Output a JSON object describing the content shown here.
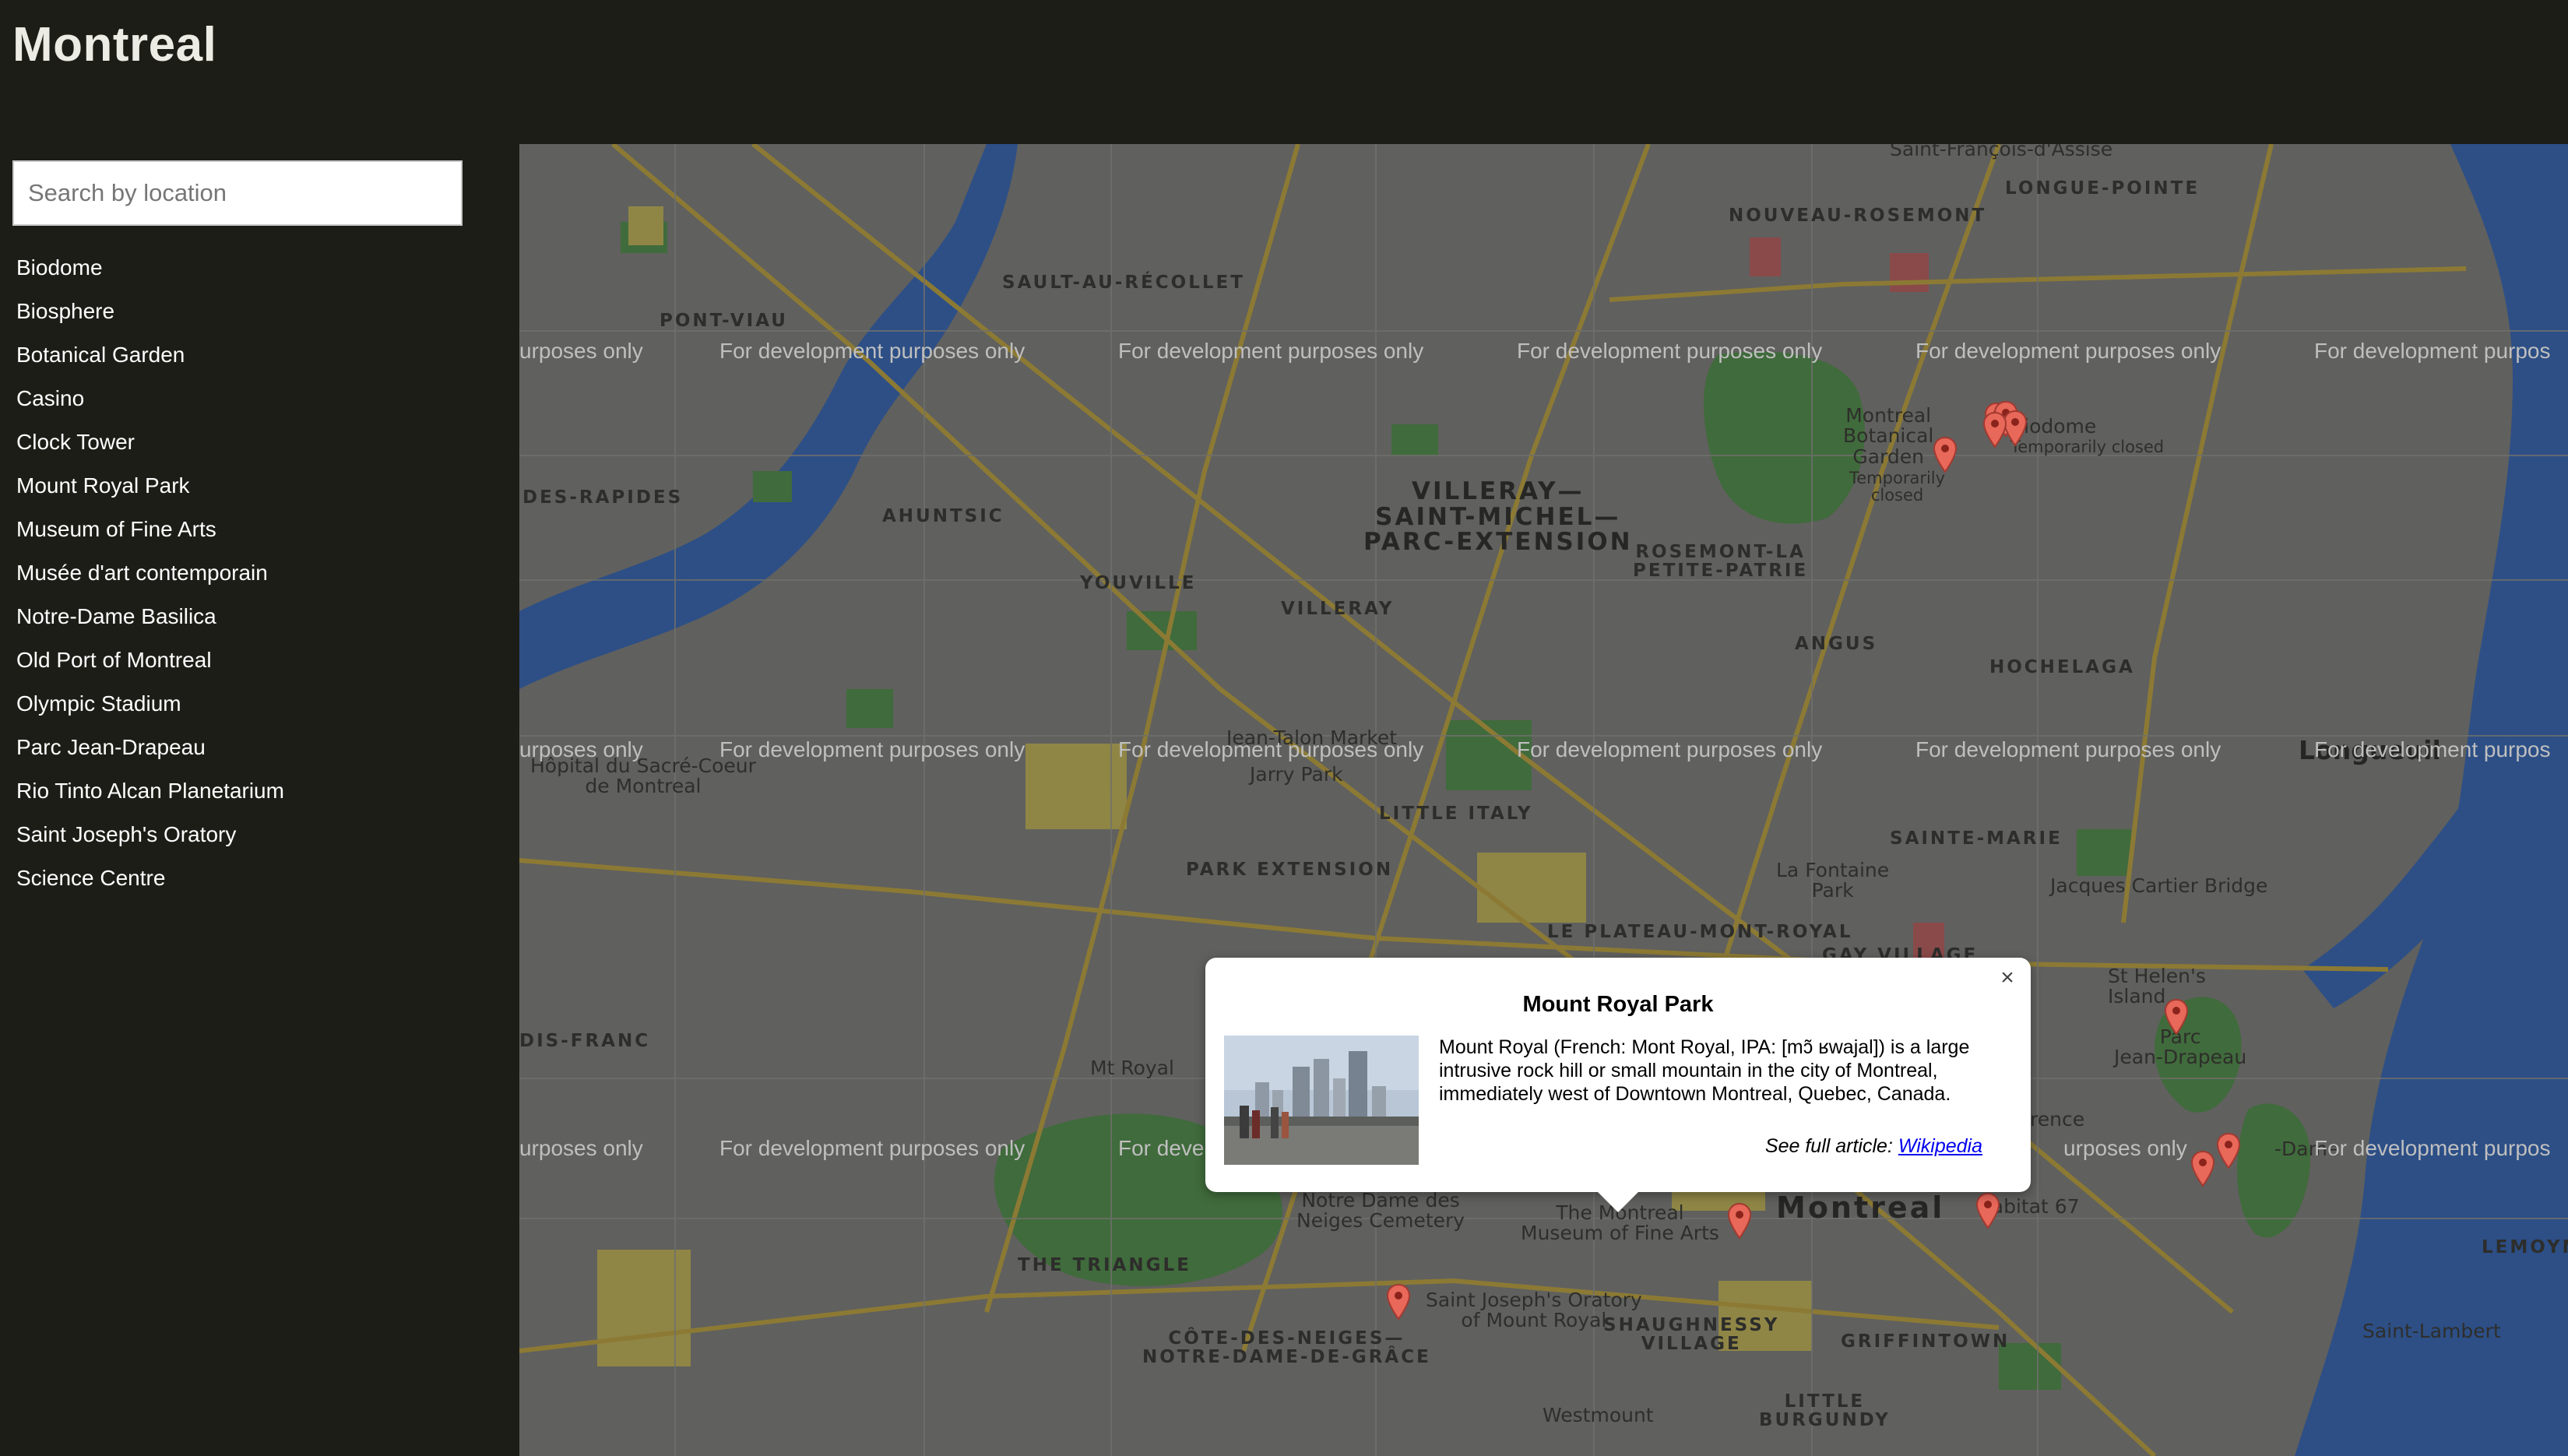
{
  "app": {
    "title": "Montreal"
  },
  "search": {
    "placeholder": "Search by location"
  },
  "locations": [
    "Biodome",
    "Biosphere",
    "Botanical Garden",
    "Casino",
    "Clock Tower",
    "Mount Royal Park",
    "Museum of Fine Arts",
    "Musée d'art contemporain",
    "Notre-Dame Basilica",
    "Old Port of Montreal",
    "Olympic Stadium",
    "Parc Jean-Drapeau",
    "Rio Tinto Alcan Planetarium",
    "Saint Joseph's Oratory",
    "Science Centre"
  ],
  "map": {
    "watermark": "For development purposes only",
    "watermark_partial_left": "urposes only",
    "watermark_partial_right": "For development purpos",
    "watermark_cut_mid": "For deve",
    "labels": {
      "nouveau_rosemont": "NOUVEAU-ROSEMONT",
      "longue_pointe": "LONGUE-POINTE",
      "sault": "SAULT-AU-RÉCOLLET",
      "pont_viau": "PONT-VIAU",
      "des_rapides": "DES-RAPIDES",
      "ahuntsic": "AHUNTSIC",
      "youville": "YOUVILLE",
      "villeray": "VILLERAY",
      "villeray_big": "VILLERAY—\nSAINT-MICHEL—\nPARC-EXTENSION",
      "rosemont": "ROSEMONT-LA\nPETITE-PATRIE",
      "angus": "ANGUS",
      "hochelaga": "HOCHELAGA",
      "little_italy": "LITTLE ITALY",
      "park_extension": "PARK EXTENSION",
      "sainte_marie": "SAINTE-MARIE",
      "plateau": "LE PLATEAU-MONT-ROYAL",
      "gay_village": "GAY VILLAGE",
      "the_triangle": "THE TRIANGLE",
      "cote_des_neiges": "CÔTE-DES-NEIGES—\nNOTRE-DAME-DE-GRÂCE",
      "shaughnessy": "SHAUGHNESSY\nVILLAGE",
      "griffintown": "GRIFFINTOWN",
      "little_burgundy": "LITTLE\nBURGUNDY",
      "lemoyne": "LEMOYNE",
      "dis_franc": "DIS-FRANC",
      "montreal_city": "Montreal",
      "longueuil": "Longueuil",
      "botanical_poi": "Montreal\nBotanical\nGarden",
      "botanical_closed": "Temporarily\nclosed",
      "biodome_poi": "Biodome",
      "biodome_closed": "Temporarily closed",
      "jean_talon": "Jean-Talon Market",
      "jarry_park": "Jarry Park",
      "la_fontaine": "La Fontaine\nPark",
      "hopital": "Hôpital du Sacré-Coeur\nde Montreal",
      "jacques_cartier": "Jacques Cartier Bridge",
      "st_helens": "St Helen's\nIsland",
      "parc_jd": "Parc\nJean-Drapeau",
      "mt_royal": "Mt Royal",
      "notre_dame_cemetery": "Notre Dame des\nNeiges Cemetery",
      "museum_poi": "The Montreal\nMuseum of Fine Arts",
      "habitat": "Habitat 67",
      "oratory_poi": "Saint Joseph's Oratory\nof Mount Royal",
      "westmount": "Westmount",
      "saint_lambert": "Saint-Lambert",
      "terence": "rence",
      "notre_dame_frag": "-Dame",
      "saint_francois": "Saint-François-d'Assise"
    }
  },
  "info_window": {
    "title": "Mount Royal Park",
    "description": "Mount Royal (French: Mont Royal, IPA: [mɔ̃ ʁwajal]) is a large intrusive rock hill or small mountain in the city of Montreal, immediately west of Downtown Montreal, Quebec, Canada.",
    "see_full": "See full article:",
    "link_text": "Wikipedia",
    "close_symbol": "×"
  },
  "colors": {
    "background": "#1d1d17",
    "map_overlay": "#60605e",
    "water": "#2d4f86",
    "park": "#406b3c",
    "road_major": "#8c7a34",
    "marker": "#e8685a"
  },
  "icons": [
    "close-icon",
    "map-marker-icon"
  ]
}
